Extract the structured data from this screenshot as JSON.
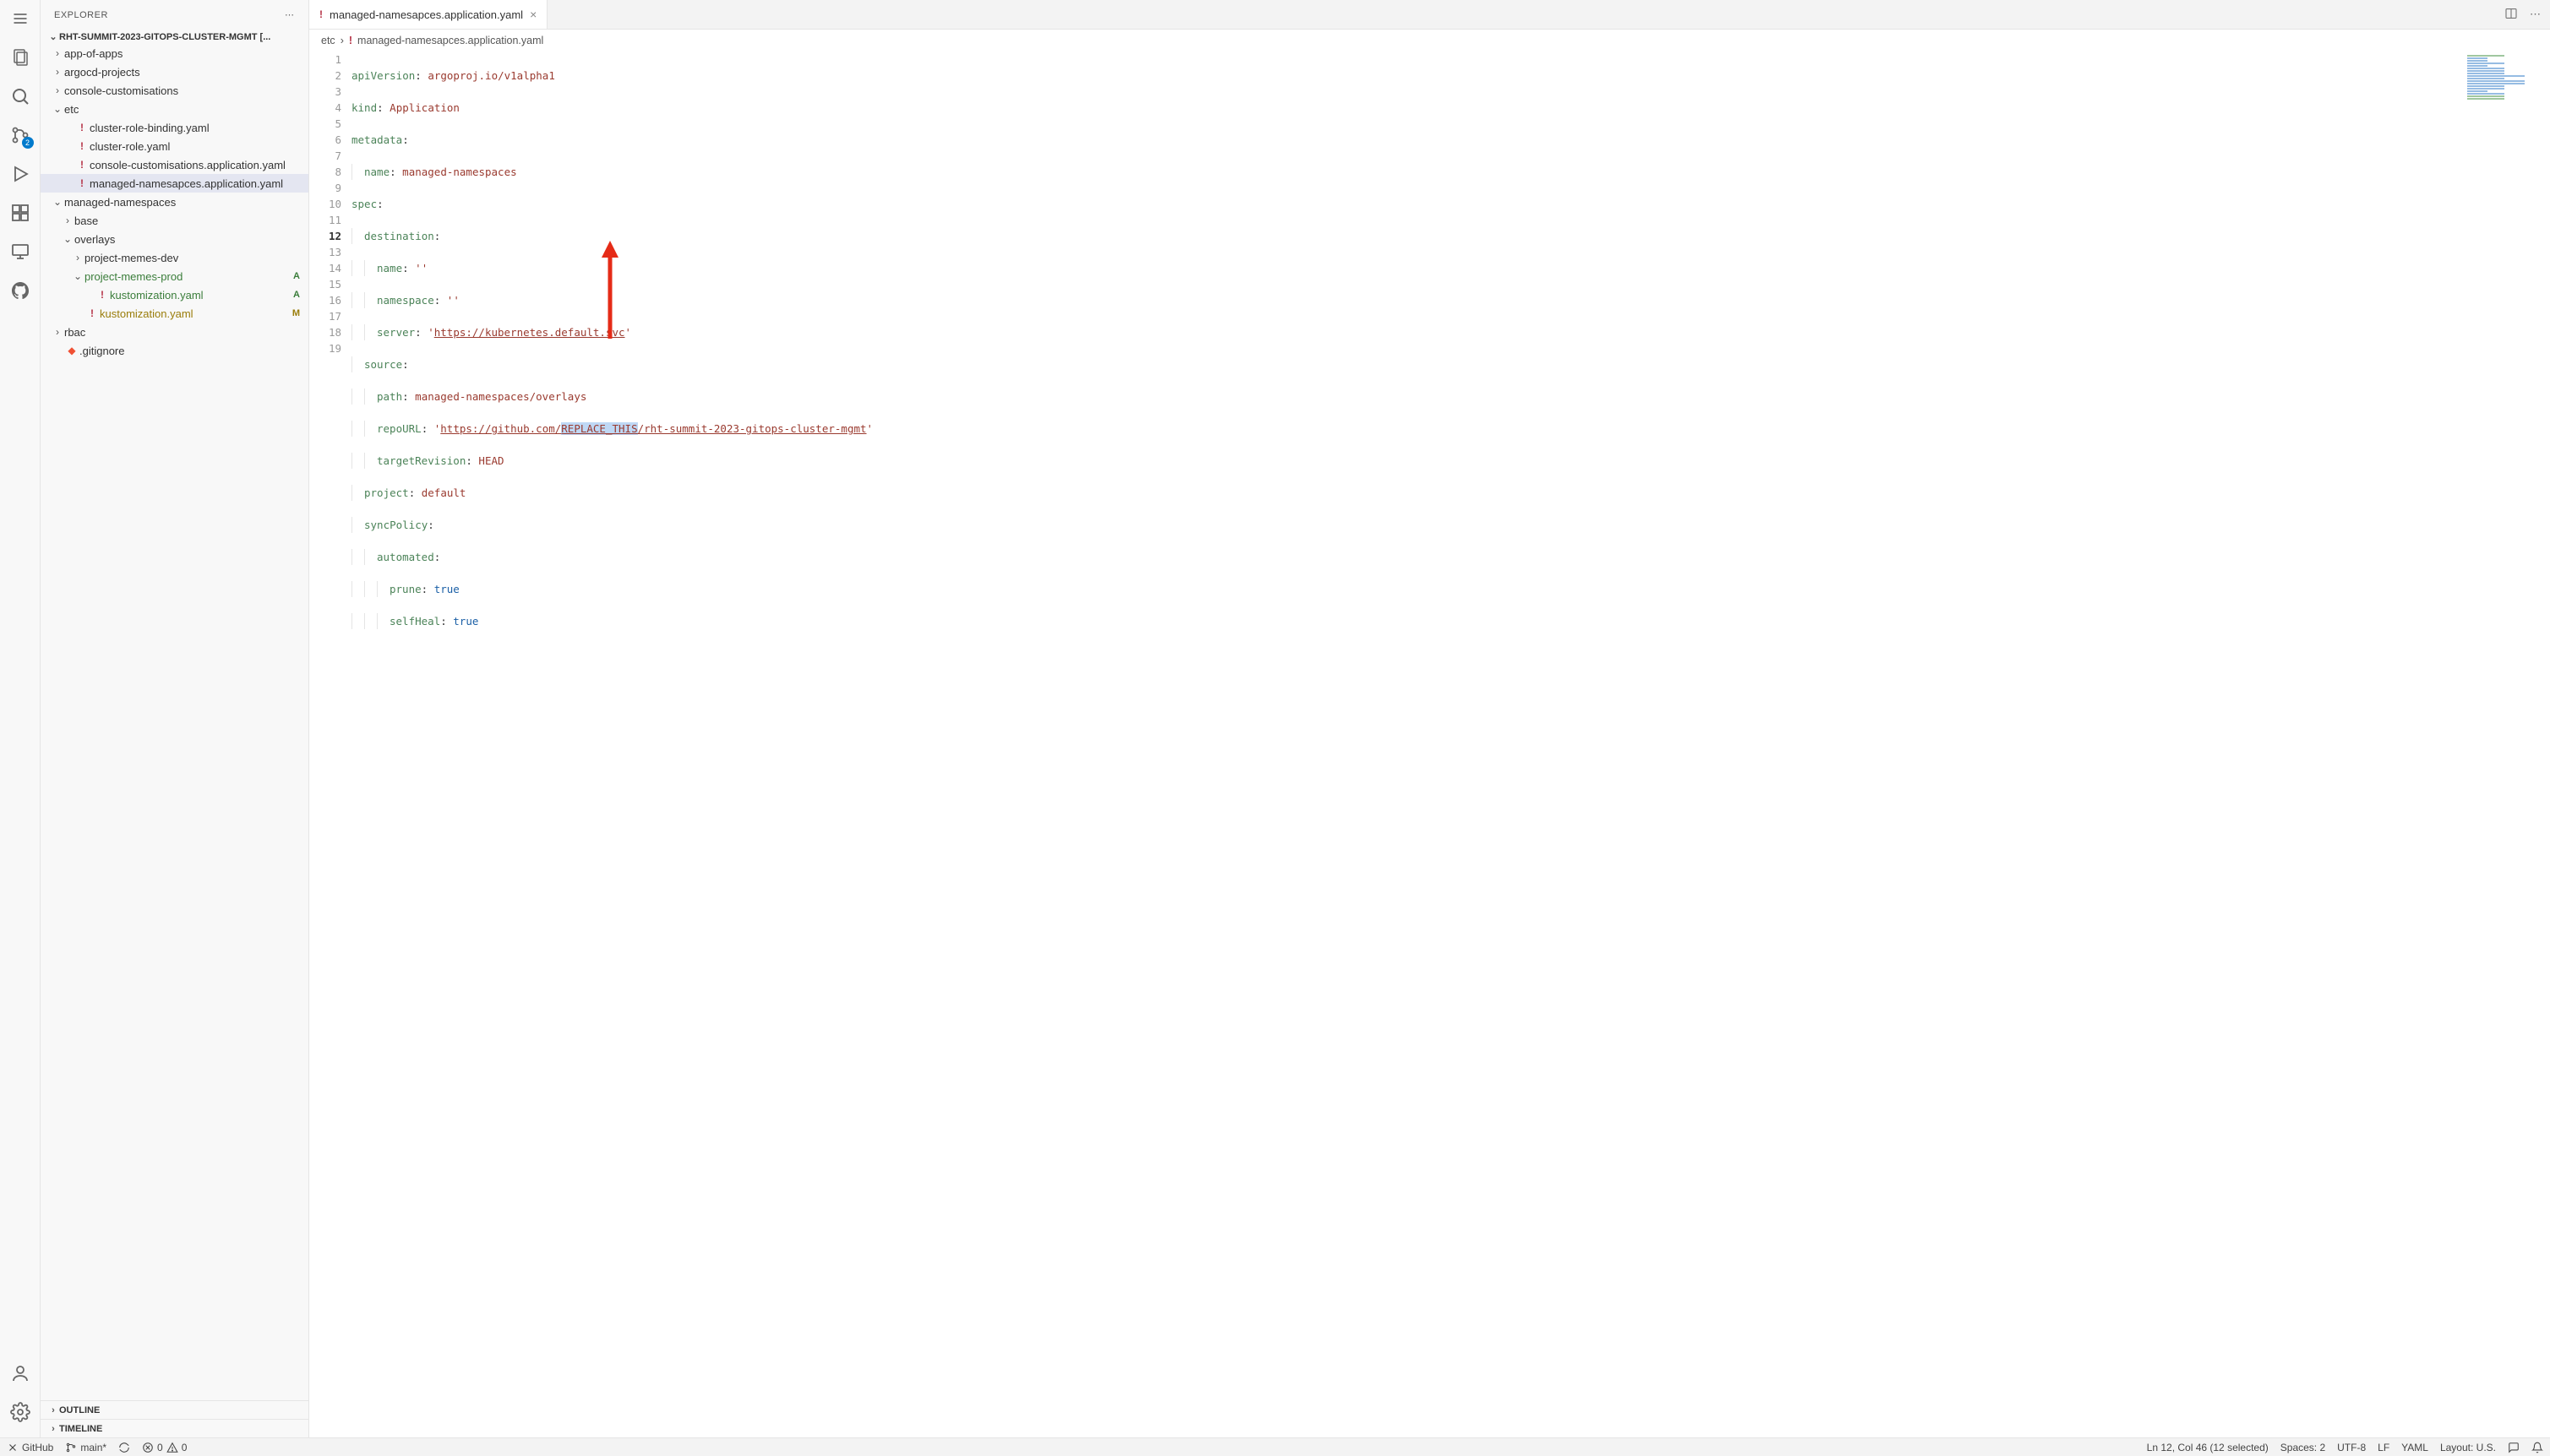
{
  "sidebar": {
    "title": "EXPLORER",
    "workspace_name": "RHT-SUMMIT-2023-GITOPS-CLUSTER-MGMT [...",
    "tree": {
      "app_of_apps": "app-of-apps",
      "argocd_projects": "argocd-projects",
      "console_customisations": "console-customisations",
      "etc": "etc",
      "etc_children": {
        "cluster_role_binding": "cluster-role-binding.yaml",
        "cluster_role": "cluster-role.yaml",
        "console_customisations_app": "console-customisations.application.yaml",
        "managed_namespaces_app": "managed-namesapces.application.yaml"
      },
      "managed_namespaces": "managed-namespaces",
      "mn_children": {
        "base": "base",
        "overlays": "overlays",
        "overlays_children": {
          "project_memes_dev": "project-memes-dev",
          "project_memes_prod": "project-memes-prod",
          "project_memes_prod_status": "A",
          "kustomization_inner": "kustomization.yaml",
          "kustomization_inner_status": "A",
          "kustomization_outer": "kustomization.yaml",
          "kustomization_outer_status": "M"
        }
      },
      "rbac": "rbac",
      "gitignore": ".gitignore"
    },
    "outline": "OUTLINE",
    "timeline": "TIMELINE"
  },
  "scm_badge": "2",
  "tab": {
    "label": "managed-namesapces.application.yaml"
  },
  "breadcrumb": {
    "part1": "etc",
    "part2": "managed-namesapces.application.yaml"
  },
  "code": {
    "l1_key": "apiVersion",
    "l1_val": "argoproj.io/v1alpha1",
    "l2_key": "kind",
    "l2_val": "Application",
    "l3_key": "metadata",
    "l4_key": "name",
    "l4_val": "managed-namespaces",
    "l5_key": "spec",
    "l6_key": "destination",
    "l7_key": "name",
    "l7_val": "''",
    "l8_key": "namespace",
    "l8_val": "''",
    "l9_key": "server",
    "l9_pre": "'",
    "l9_url": "https://kubernetes.default.svc",
    "l9_post": "'",
    "l10_key": "source",
    "l11_key": "path",
    "l11_val": "managed-namespaces/overlays",
    "l12_key": "repoURL",
    "l12_pre": "'",
    "l12_u1": "https://github.com/",
    "l12_sel": "REPLACE_THIS",
    "l12_u2": "/rht-summit-2023-gitops-cluster-mgmt",
    "l12_post": "'",
    "l13_key": "targetRevision",
    "l13_val": "HEAD",
    "l14_key": "project",
    "l14_val": "default",
    "l15_key": "syncPolicy",
    "l16_key": "automated",
    "l17_key": "prune",
    "l17_val": "true",
    "l18_key": "selfHeal",
    "l18_val": "true"
  },
  "line_numbers": [
    "1",
    "2",
    "3",
    "4",
    "5",
    "6",
    "7",
    "8",
    "9",
    "10",
    "11",
    "12",
    "13",
    "14",
    "15",
    "16",
    "17",
    "18",
    "19"
  ],
  "statusbar": {
    "remote": "GitHub",
    "branch": "main*",
    "errors": "0",
    "warnings": "0",
    "cursor": "Ln 12, Col 46 (12 selected)",
    "spaces": "Spaces: 2",
    "encoding": "UTF-8",
    "eol": "LF",
    "language": "YAML",
    "layout": "Layout: U.S."
  }
}
